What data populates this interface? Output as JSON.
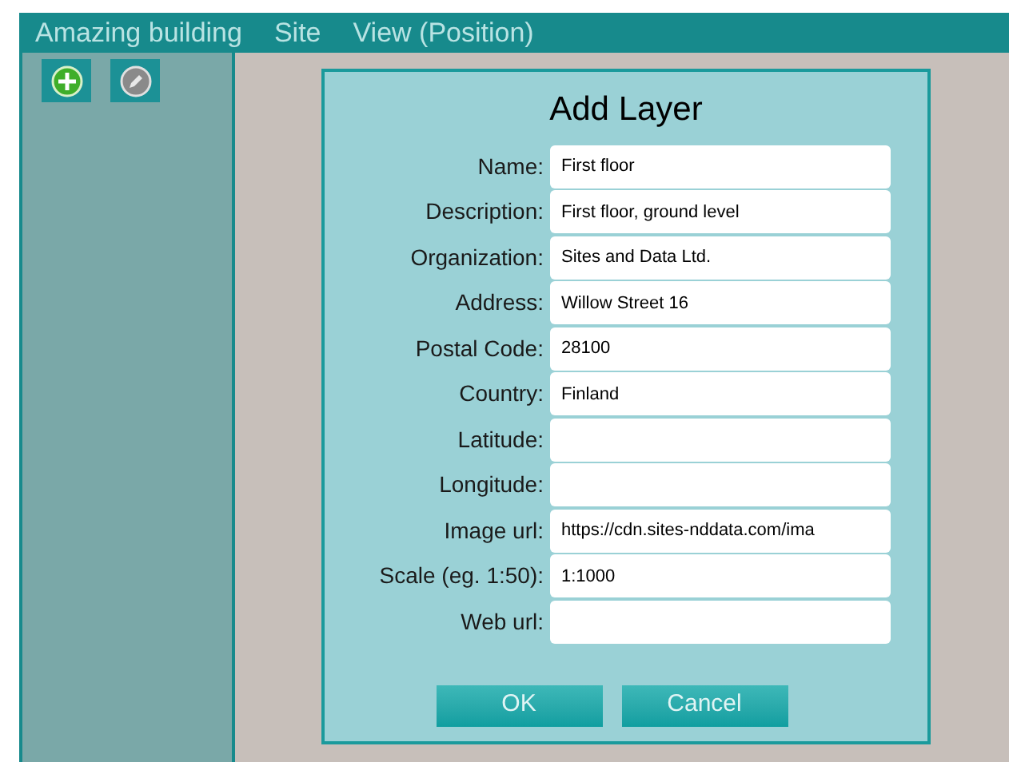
{
  "menu_bar": {
    "items": [
      "Amazing building",
      "Site",
      "View (Position)"
    ]
  },
  "toolbar": {
    "buttons": [
      {
        "kind": "add"
      },
      {
        "kind": "edit"
      }
    ]
  },
  "dialog": {
    "title": "Add Layer",
    "fields": [
      {
        "label": "Name:",
        "value": "First floor"
      },
      {
        "label": "Description:",
        "value": "First floor, ground level"
      },
      {
        "label": "Organization:",
        "value": "Sites and Data Ltd."
      },
      {
        "label": "Address:",
        "value": "Willow Street 16"
      },
      {
        "label": "Postal Code:",
        "value": "28100"
      },
      {
        "label": "Country:",
        "value": "Finland"
      },
      {
        "label": "Latitude:"
      },
      {
        "label": "Longitude:"
      },
      {
        "label": "Image url:",
        "value": "https://cdn.sites-nddata.com/ima"
      },
      {
        "label": "Scale (eg. 1:50):",
        "value": "1:1000"
      },
      {
        "label": "Web url:"
      }
    ],
    "buttons": [
      "OK",
      "Cancel"
    ]
  }
}
